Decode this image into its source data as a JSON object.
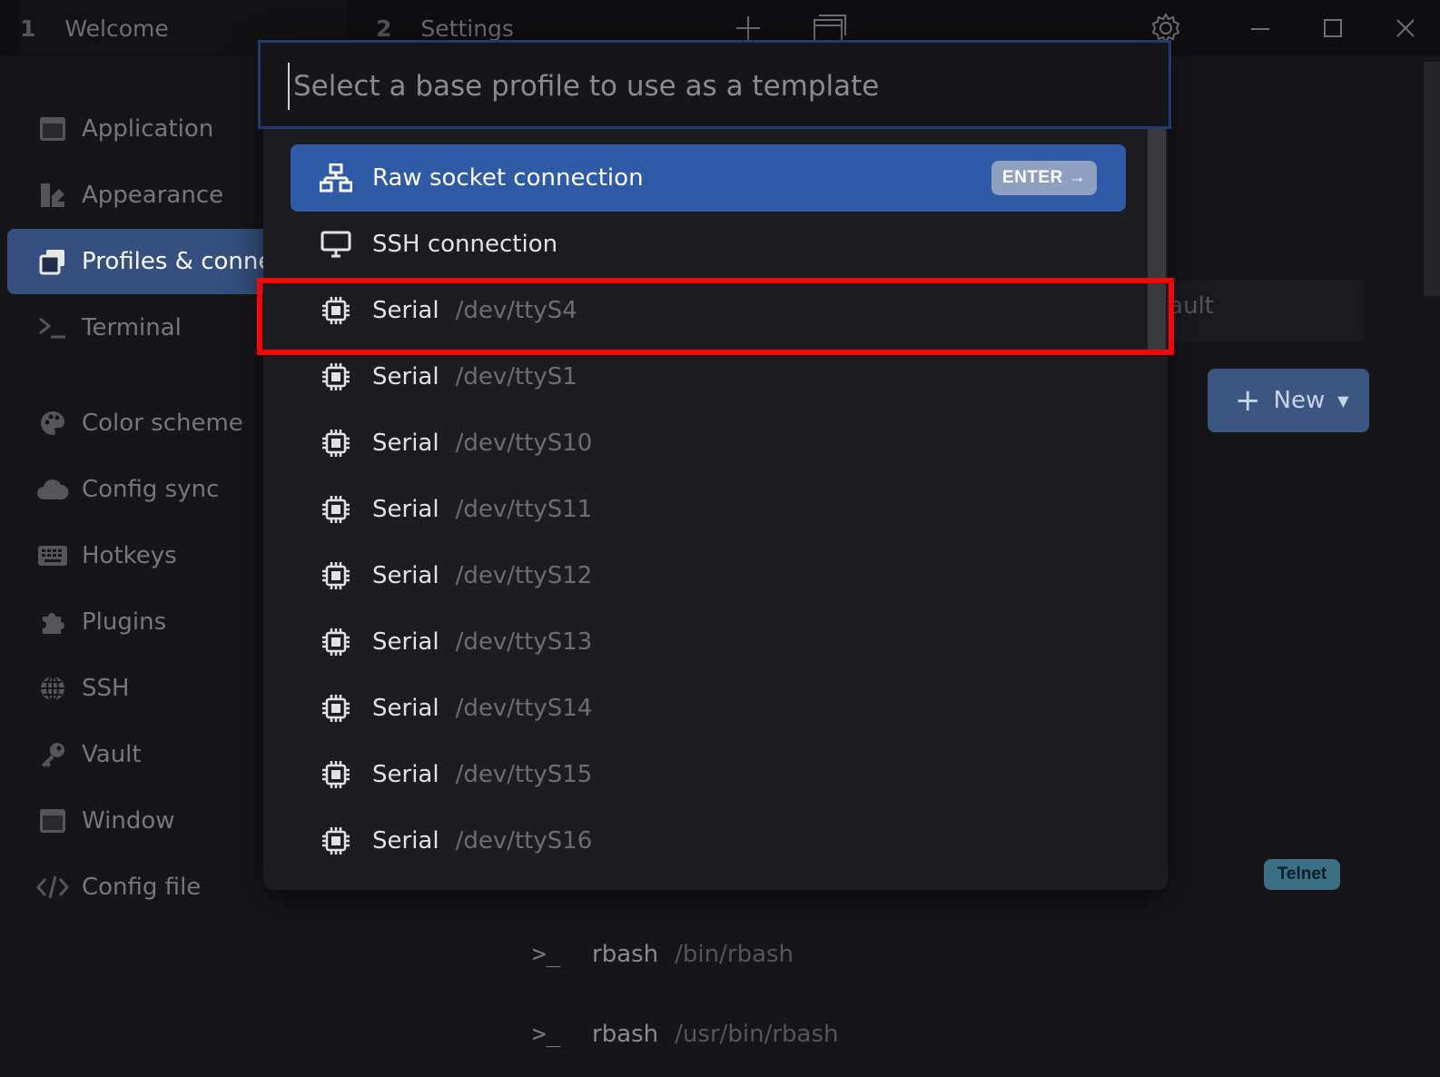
{
  "titlebar": {
    "tabs": [
      {
        "index": "1",
        "label": "Welcome"
      },
      {
        "index": "2",
        "label": "Settings"
      }
    ],
    "icons": [
      "plus-icon",
      "window-icon",
      "gear-icon",
      "minimize-icon",
      "maximize-icon",
      "close-icon"
    ]
  },
  "sidebar": {
    "items": [
      {
        "label": "Application",
        "icon": "application-icon"
      },
      {
        "label": "Appearance",
        "icon": "appearance-icon"
      },
      {
        "label": "Profiles & connec",
        "icon": "profiles-icon",
        "active": true
      },
      {
        "label": "Terminal",
        "icon": "terminal-icon"
      },
      {
        "label": "Color scheme",
        "icon": "palette-icon"
      },
      {
        "label": "Config sync",
        "icon": "cloud-icon"
      },
      {
        "label": "Hotkeys",
        "icon": "keyboard-icon"
      },
      {
        "label": "Plugins",
        "icon": "puzzle-icon"
      },
      {
        "label": "SSH",
        "icon": "globe-icon"
      },
      {
        "label": "Vault",
        "icon": "key-icon"
      },
      {
        "label": "Window",
        "icon": "window-icon"
      },
      {
        "label": "Config file",
        "icon": "code-icon"
      }
    ]
  },
  "background": {
    "default_text": "fault",
    "new_button": "New",
    "telnet_badge": "Telnet",
    "rows": [
      {
        "name": "rbash",
        "path": "/bin/rbash"
      },
      {
        "name": "rbash",
        "path": "/usr/bin/rbash"
      }
    ]
  },
  "dialog": {
    "placeholder": "Select a base profile to use as a template",
    "enter_label": "ENTER",
    "options": [
      {
        "name": "Raw socket connection",
        "desc": "",
        "icon": "network-icon"
      },
      {
        "name": "SSH connection",
        "desc": "",
        "icon": "desktop-icon"
      },
      {
        "name": "Serial",
        "desc": "/dev/ttyS4",
        "icon": "chip-icon"
      },
      {
        "name": "Serial",
        "desc": "/dev/ttyS1",
        "icon": "chip-icon"
      },
      {
        "name": "Serial",
        "desc": "/dev/ttyS10",
        "icon": "chip-icon"
      },
      {
        "name": "Serial",
        "desc": "/dev/ttyS11",
        "icon": "chip-icon"
      },
      {
        "name": "Serial",
        "desc": "/dev/ttyS12",
        "icon": "chip-icon"
      },
      {
        "name": "Serial",
        "desc": "/dev/ttyS13",
        "icon": "chip-icon"
      },
      {
        "name": "Serial",
        "desc": "/dev/ttyS14",
        "icon": "chip-icon"
      },
      {
        "name": "Serial",
        "desc": "/dev/ttyS15",
        "icon": "chip-icon"
      },
      {
        "name": "Serial",
        "desc": "/dev/ttyS16",
        "icon": "chip-icon"
      }
    ]
  },
  "colors": {
    "accent": "#2f5aa6",
    "highlight": "#ff0000",
    "sidebar_active": "#35507e"
  }
}
